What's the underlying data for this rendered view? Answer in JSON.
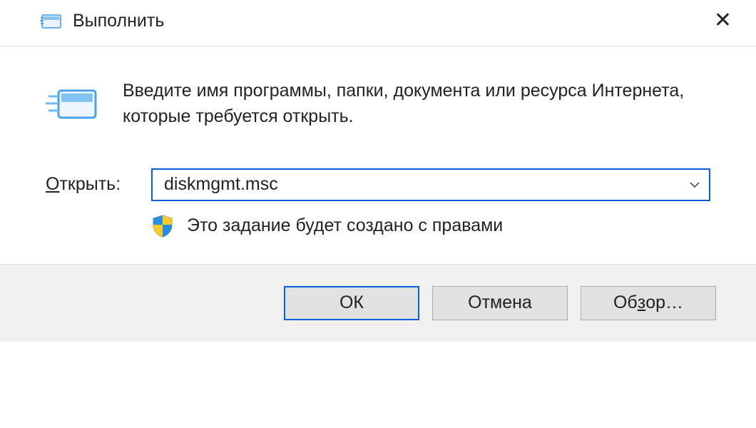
{
  "titlebar": {
    "title": "Выполнить"
  },
  "content": {
    "description": "Введите имя программы, папки, документа или ресурса Интернета, которые требуется открыть.",
    "open_label_prefix": "О",
    "open_label_rest": "ткрыть:",
    "input_value": "diskmgmt.msc",
    "admin_note": "Это задание будет создано с правами"
  },
  "buttons": {
    "ok": "ОК",
    "cancel": "Отмена",
    "browse_prefix": "Об",
    "browse_accel": "з",
    "browse_rest": "ор…"
  }
}
